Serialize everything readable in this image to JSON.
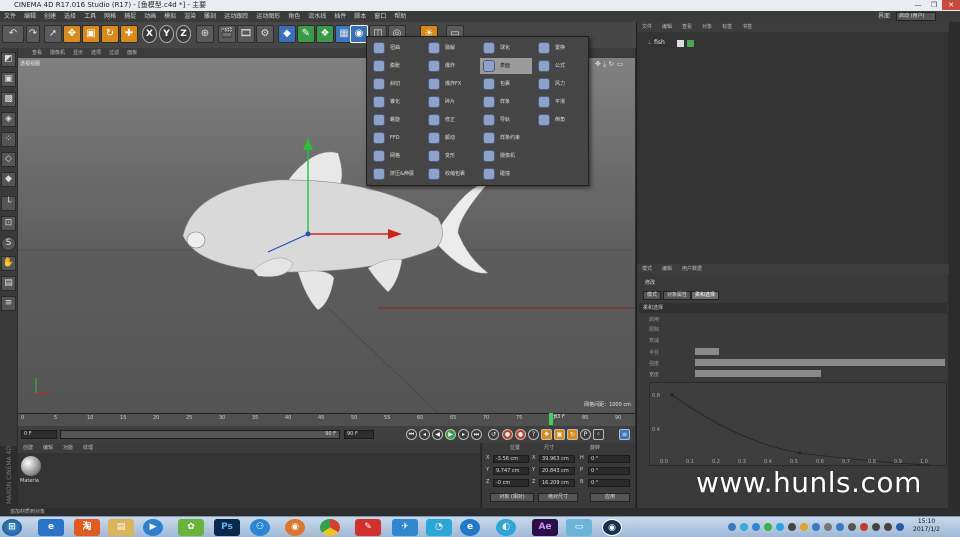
{
  "window": {
    "title": "CINEMA 4D R17.016 Studio (R17) - [鱼模型.c4d *] - 主要",
    "layout_label": "界面",
    "layout_value": "启动 (用户)"
  },
  "menubar": [
    "文件",
    "编辑",
    "创建",
    "选择",
    "工具",
    "网格",
    "捕捉",
    "动画",
    "模拟",
    "渲染",
    "雕刻",
    "运动跟踪",
    "运动图形",
    "角色",
    "流水线",
    "插件",
    "脚本",
    "窗口",
    "帮助"
  ],
  "toolbar": {
    "axes": [
      "X",
      "Y",
      "Z"
    ]
  },
  "viewport": {
    "menu": [
      "查看",
      "摄像机",
      "显示",
      "选项",
      "过滤",
      "面板"
    ],
    "label": "透视视图",
    "grid_scale": "网格间距：1000 cm"
  },
  "popup": {
    "col1": [
      "扭曲",
      "膨胀",
      "斜切",
      "锥化",
      "螺旋",
      "FFD",
      "网格",
      "挤压&伸展",
      "融解",
      "爆炸",
      "爆炸FX",
      "碎片",
      "修正",
      "颤动",
      "变形",
      "收缩包裹",
      "球化",
      "表面",
      "包裹",
      "样条",
      "导轨",
      "样条约束",
      "摄像机",
      "碰撞",
      "置换",
      "公式",
      "风力",
      "平滑",
      "倒角"
    ],
    "highlight": "表面"
  },
  "timeline": {
    "ticks": [
      "0",
      "5",
      "10",
      "15",
      "20",
      "25",
      "30",
      "35",
      "40",
      "45",
      "50",
      "55",
      "60",
      "65",
      "70",
      "75",
      "80",
      "85",
      "90"
    ],
    "current": "83 F",
    "start": "0 F",
    "end": "90 F",
    "end2": "90 F",
    "frame_field": "83 F"
  },
  "materials": {
    "menu": [
      "创建",
      "编辑",
      "功能",
      "纹理"
    ],
    "item": "Materia"
  },
  "coords": {
    "headers": [
      "位置",
      "尺寸",
      "旋转"
    ],
    "rows": [
      {
        "axis": "X",
        "pos": "-3.56 cm",
        "size": "39.963 cm",
        "rlabel": "H",
        "rot": "0 °"
      },
      {
        "axis": "Y",
        "pos": "9.747 cm",
        "size": "20.843 cm",
        "rlabel": "P",
        "rot": "0 °"
      },
      {
        "axis": "Z",
        "pos": "-0 cm",
        "size": "16.209 cm",
        "rlabel": "B",
        "rot": "0 °"
      }
    ],
    "mode1": "对象 (相对)",
    "mode2": "绝对尺寸",
    "apply": "应用"
  },
  "objects": {
    "menu": [
      "文件",
      "编辑",
      "查看",
      "对象",
      "标签",
      "书签"
    ],
    "item": "fish"
  },
  "attributes": {
    "menu": [
      "模式",
      "编辑",
      "用户数据"
    ],
    "title": "修改",
    "tabs": [
      "模式",
      "对象属性",
      "柔和选择"
    ],
    "section": "柔和选择",
    "rows": [
      "启用",
      "限制",
      "衰减",
      "半径",
      "强度",
      "宽度"
    ],
    "graph_x": [
      "0.0",
      "0.1",
      "0.2",
      "0.3",
      "0.4",
      "0.5",
      "0.6",
      "0.7",
      "0.8",
      "0.9",
      "1.0"
    ],
    "graph_y": [
      "0.8",
      "0.4"
    ]
  },
  "status": "追加材质到对象",
  "watermark": "www.hunls.com",
  "clock": {
    "time": "15:10",
    "date": "2017/1/2"
  }
}
